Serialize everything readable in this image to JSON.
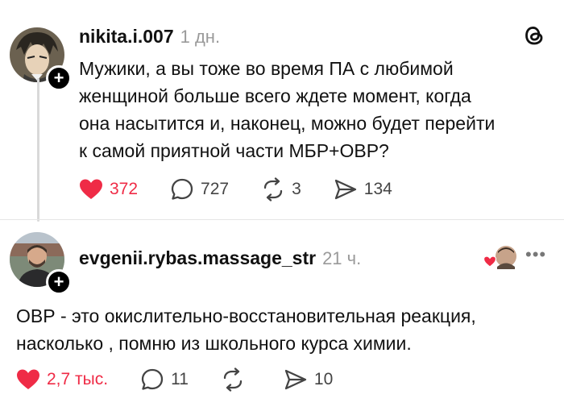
{
  "post": {
    "username": "nikita.i.007",
    "time": "1 дн.",
    "text": "Мужики, а вы тоже во время ПА с любимой\nженщиной больше всего ждете момент, когда\nона насытится и, наконец, можно будет перейти\nк самой приятной части МБР+ОВР?",
    "likes": "372",
    "comments": "727",
    "reposts": "3",
    "shares": "134",
    "liked": true
  },
  "reply": {
    "username": "evgenii.rybas.massage_str",
    "time": "21 ч.",
    "text": "ОВР - это окислительно-восстановительная реакция,\nнасколько , помню из школьного курса химии.",
    "likes": "2,7 тыс.",
    "comments": "11",
    "reposts": "",
    "shares": "10",
    "liked": true
  },
  "colors": {
    "like_red": "#ef2b46",
    "time_gray": "#9a9a9a",
    "icon_gray": "#444444"
  },
  "icons": [
    "threads-logo-icon",
    "heart-icon",
    "comment-icon",
    "repost-icon",
    "share-icon",
    "more-icon",
    "follow-plus-icon"
  ]
}
